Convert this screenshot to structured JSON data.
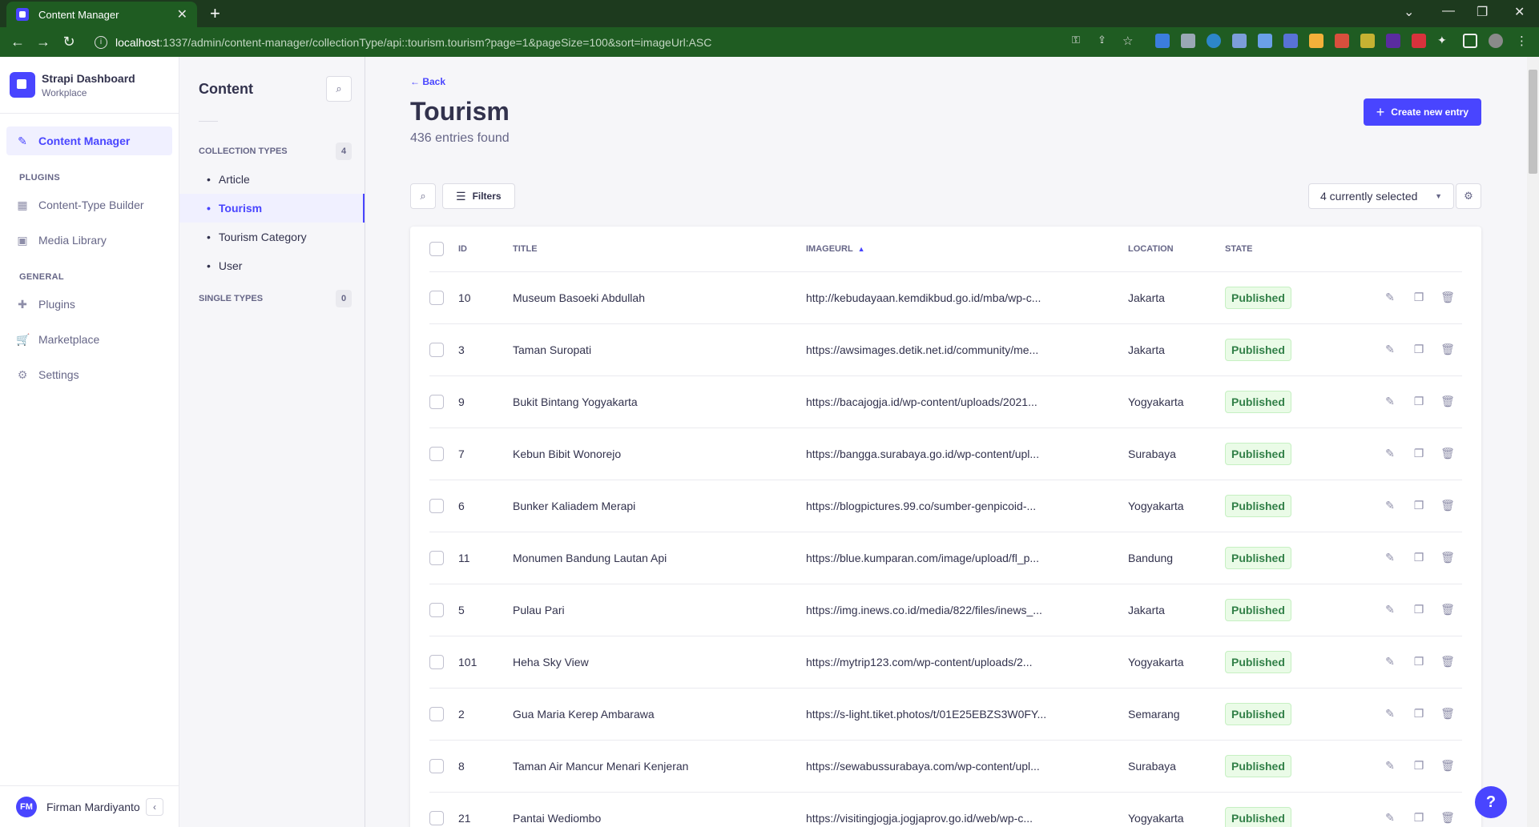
{
  "browser": {
    "tab_title": "Content Manager",
    "url_host": "localhost",
    "url_path": ":1337/admin/content-manager/collectionType/api::tourism.tourism?page=1&pageSize=100&sort=imageUrl:ASC"
  },
  "sidebar": {
    "brand_name": "Strapi Dashboard",
    "brand_sub": "Workplace",
    "content_manager": "Content Manager",
    "plugins_heading": "PLUGINS",
    "plugins": [
      {
        "label": "Content-Type Builder",
        "icon": "layout-icon"
      },
      {
        "label": "Media Library",
        "icon": "image-icon"
      }
    ],
    "general_heading": "GENERAL",
    "general": [
      {
        "label": "Plugins",
        "icon": "puzzle-icon"
      },
      {
        "label": "Marketplace",
        "icon": "cart-icon"
      },
      {
        "label": "Settings",
        "icon": "gear-icon"
      }
    ],
    "user_initials": "FM",
    "user_name": "Firman Mardiyanto"
  },
  "subnav": {
    "title": "Content",
    "collection_heading": "COLLECTION TYPES",
    "collection_count": "4",
    "collections": [
      "Article",
      "Tourism",
      "Tourism Category",
      "User"
    ],
    "single_heading": "SINGLE TYPES",
    "single_count": "0"
  },
  "main": {
    "back_label": "Back",
    "title": "Tourism",
    "subtitle": "436 entries found",
    "create_label": "Create new entry",
    "filters_label": "Filters",
    "columns_select": "4 currently selected"
  },
  "table": {
    "headers": {
      "id": "ID",
      "title": "TITLE",
      "imageurl": "IMAGEURL",
      "location": "LOCATION",
      "state": "STATE"
    },
    "rows": [
      {
        "id": "10",
        "title": "Museum Basoeki Abdullah",
        "url": "http://kebudayaan.kemdikbud.go.id/mba/wp-c...",
        "location": "Jakarta",
        "state": "Published"
      },
      {
        "id": "3",
        "title": "Taman Suropati",
        "url": "https://awsimages.detik.net.id/community/me...",
        "location": "Jakarta",
        "state": "Published"
      },
      {
        "id": "9",
        "title": "Bukit Bintang Yogyakarta",
        "url": "https://bacajogja.id/wp-content/uploads/2021...",
        "location": "Yogyakarta",
        "state": "Published"
      },
      {
        "id": "7",
        "title": "Kebun Bibit Wonorejo",
        "url": "https://bangga.surabaya.go.id/wp-content/upl...",
        "location": "Surabaya",
        "state": "Published"
      },
      {
        "id": "6",
        "title": "Bunker Kaliadem Merapi",
        "url": "https://blogpictures.99.co/sumber-genpicoid-...",
        "location": "Yogyakarta",
        "state": "Published"
      },
      {
        "id": "11",
        "title": "Monumen Bandung Lautan Api",
        "url": "https://blue.kumparan.com/image/upload/fl_p...",
        "location": "Bandung",
        "state": "Published"
      },
      {
        "id": "5",
        "title": "Pulau Pari",
        "url": "https://img.inews.co.id/media/822/files/inews_...",
        "location": "Jakarta",
        "state": "Published"
      },
      {
        "id": "101",
        "title": "Heha Sky View",
        "url": "https://mytrip123.com/wp-content/uploads/2...",
        "location": "Yogyakarta",
        "state": "Published"
      },
      {
        "id": "2",
        "title": "Gua Maria Kerep Ambarawa",
        "url": "https://s-light.tiket.photos/t/01E25EBZS3W0FY...",
        "location": "Semarang",
        "state": "Published"
      },
      {
        "id": "8",
        "title": "Taman Air Mancur Menari Kenjeran",
        "url": "https://sewabussurabaya.com/wp-content/upl...",
        "location": "Surabaya",
        "state": "Published"
      },
      {
        "id": "21",
        "title": "Pantai Wediombo",
        "url": "https://visitingjogja.jogjaprov.go.id/web/wp-c...",
        "location": "Yogyakarta",
        "state": "Published"
      }
    ]
  },
  "colors": {
    "primary": "#4945ff",
    "published_bg": "#eafbe7",
    "published_text": "#328048",
    "browser_frame": "#1f5c22"
  }
}
